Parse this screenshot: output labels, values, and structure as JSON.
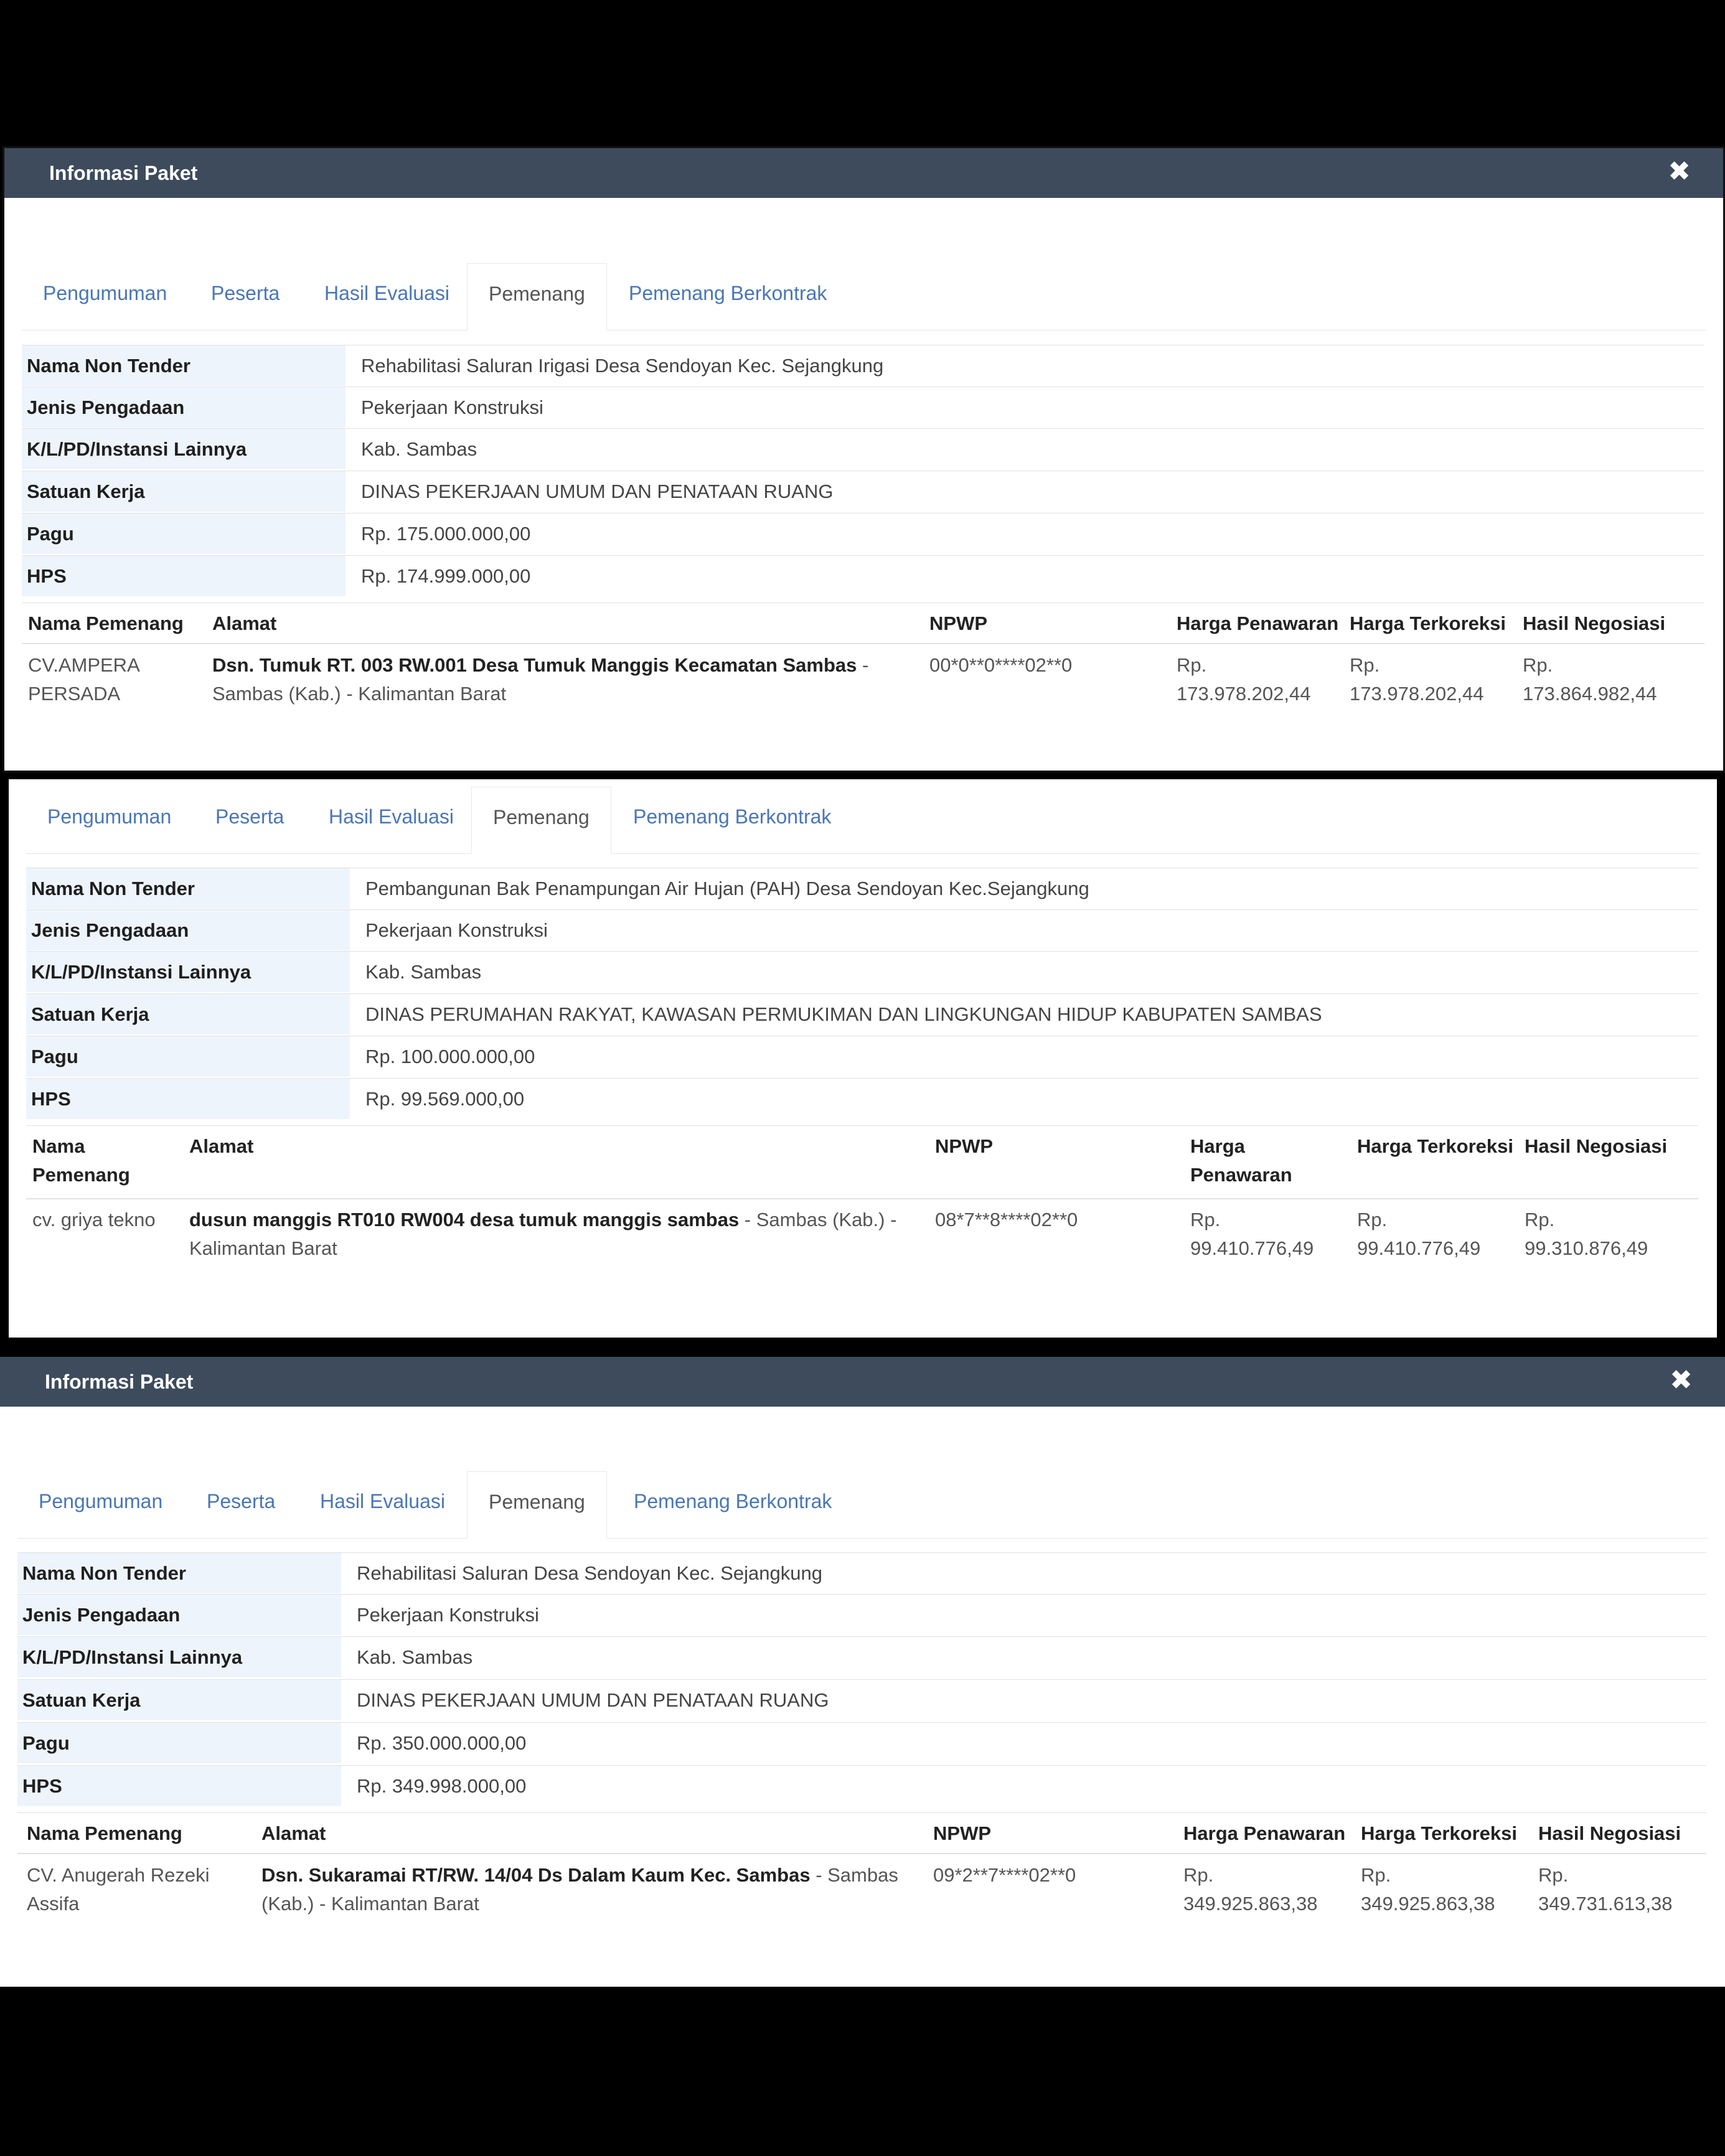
{
  "tabs": [
    "Pengumuman",
    "Peserta",
    "Hasil Evaluasi",
    "Pemenang",
    "Pemenang Berkontrak"
  ],
  "labels": {
    "nama": "Nama Non Tender",
    "jenis": "Jenis Pengadaan",
    "klpd": "K/L/PD/Instansi Lainnya",
    "satker": "Satuan Kerja",
    "pagu": "Pagu",
    "hps": "HPS"
  },
  "table_headers": {
    "nama": "Nama Pemenang",
    "alamat": "Alamat",
    "npwp": "NPWP",
    "penawaran": "Harga Penawaran",
    "terkoreksi": "Harga Terkoreksi",
    "negosiasi": "Hasil Negosiasi"
  },
  "panels": [
    {
      "title": "Informasi Paket",
      "nama_non_tender": "Rehabilitasi Saluran Irigasi Desa Sendoyan Kec. Sejangkung",
      "jenis_pengadaan": "Pekerjaan Konstruksi",
      "klpd": "Kab. Sambas",
      "satuan_kerja": "DINAS PEKERJAAN UMUM DAN PENATAAN RUANG",
      "pagu": "Rp. 175.000.000,00",
      "hps": "Rp. 174.999.000,00",
      "winner": {
        "nama_line1": "CV.AMPERA",
        "nama_line2": "PERSADA",
        "alamat_bold": "Dsn. Tumuk RT. 003 RW.001 Desa Tumuk Manggis Kecamatan Sambas",
        "alamat_rest1": " -",
        "alamat_rest2": "Sambas (Kab.) - Kalimantan Barat",
        "npwp": "00*0**0****02**0",
        "penawaran_rp": "Rp.",
        "penawaran": "173.978.202,44",
        "terkoreksi_rp": "Rp.",
        "terkoreksi": "173.978.202,44",
        "negosiasi_rp": "Rp.",
        "negosiasi": "173.864.982,44"
      }
    },
    {
      "nama_non_tender": "Pembangunan Bak Penampungan Air Hujan (PAH) Desa Sendoyan Kec.Sejangkung",
      "jenis_pengadaan": "Pekerjaan Konstruksi",
      "klpd": "Kab. Sambas",
      "satuan_kerja": "DINAS PERUMAHAN RAKYAT, KAWASAN PERMUKIMAN DAN LINGKUNGAN HIDUP KABUPATEN SAMBAS",
      "pagu": "Rp. 100.000.000,00",
      "hps": "Rp. 99.569.000,00",
      "header_split": {
        "nama_line1": "Nama",
        "nama_line2": "Pemenang",
        "penawaran_line1": "Harga",
        "penawaran_line2": "Penawaran"
      },
      "winner": {
        "nama_line1": "cv. griya tekno",
        "alamat_bold": "dusun manggis RT010 RW004 desa tumuk manggis sambas",
        "alamat_rest1": " - Sambas (Kab.) -",
        "alamat_rest2": "Kalimantan Barat",
        "npwp": "08*7**8****02**0",
        "penawaran_rp": "Rp.",
        "penawaran": "99.410.776,49",
        "terkoreksi_rp": "Rp.",
        "terkoreksi": "99.410.776,49",
        "negosiasi_rp": "Rp.",
        "negosiasi": "99.310.876,49"
      }
    },
    {
      "title": "Informasi Paket",
      "nama_non_tender": "Rehabilitasi Saluran Desa Sendoyan Kec. Sejangkung",
      "jenis_pengadaan": "Pekerjaan Konstruksi",
      "klpd": "Kab. Sambas",
      "satuan_kerja": "DINAS PEKERJAAN UMUM DAN PENATAAN RUANG",
      "pagu": "Rp. 350.000.000,00",
      "hps": "Rp. 349.998.000,00",
      "winner": {
        "nama_line1": "CV. Anugerah Rezeki",
        "nama_line2": "Assifa",
        "alamat_bold": "Dsn. Sukaramai RT/RW. 14/04 Ds Dalam Kaum Kec. Sambas",
        "alamat_rest1": " - Sambas",
        "alamat_rest2": "(Kab.) - Kalimantan Barat",
        "npwp": "09*2**7****02**0",
        "penawaran_rp": "Rp.",
        "penawaran": "349.925.863,38",
        "terkoreksi_rp": "Rp.",
        "terkoreksi": "349.925.863,38",
        "negosiasi_rp": "Rp.",
        "negosiasi": "349.731.613,38"
      }
    }
  ]
}
